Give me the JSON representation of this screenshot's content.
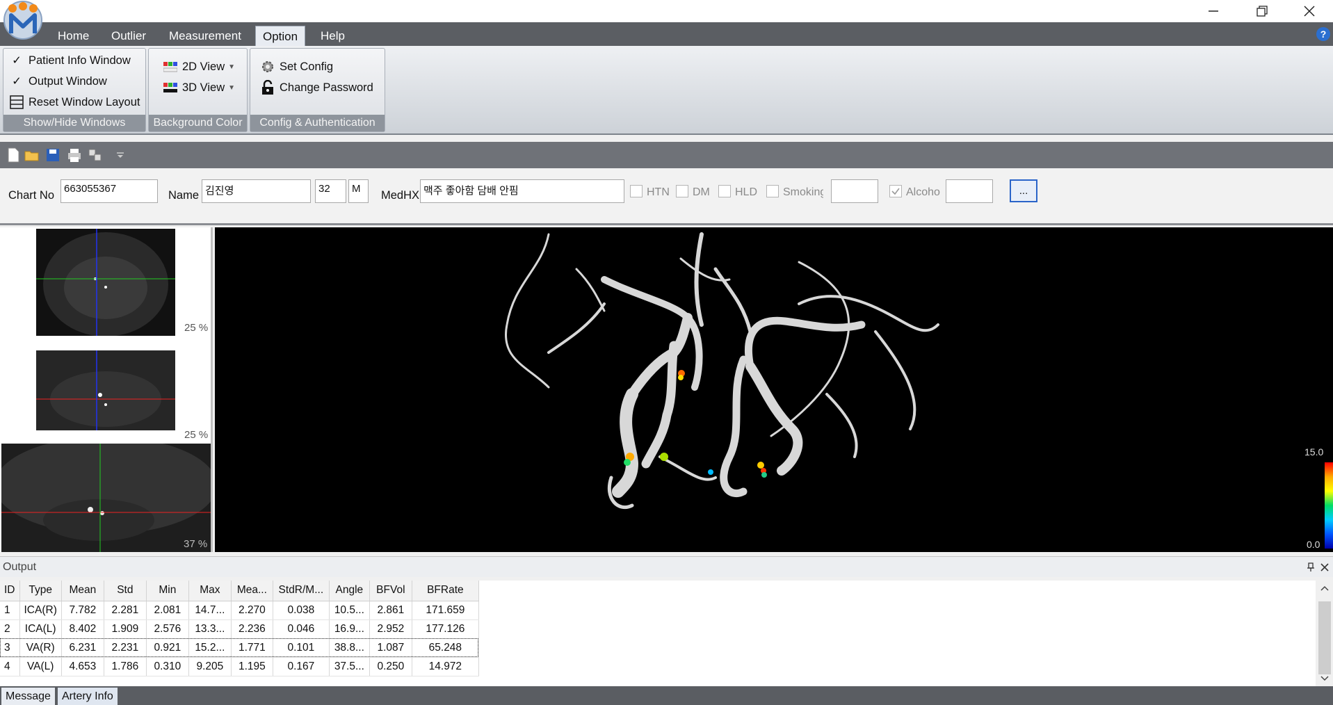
{
  "window": {
    "minimize_icon": "minimize-icon",
    "restore_icon": "restore-icon",
    "close_icon": "close-icon"
  },
  "menu": {
    "items": [
      "Home",
      "Outlier",
      "Measurement",
      "Option",
      "Help"
    ],
    "active": "Option",
    "help_icon": "?"
  },
  "ribbon": {
    "show_hide": {
      "label": "Show/Hide Windows",
      "patient_info": "Patient Info Window",
      "output": "Output Window",
      "reset": "Reset Window Layout",
      "check_mark": "✓"
    },
    "background": {
      "label": "Background Color",
      "view2d": "2D View",
      "view3d": "3D View"
    },
    "config": {
      "label": "Config & Authentication",
      "set_config": "Set Config",
      "change_password": "Change Password"
    }
  },
  "patient": {
    "chart_no_label": "Chart No",
    "chart_no": "663055367",
    "name_label": "Name",
    "name": "김진영",
    "age": "32",
    "sex": "M",
    "medhx_label": "MedHX",
    "medhx": "맥주 좋아함 담배 안핌",
    "htn": "HTN",
    "dm": "DM",
    "hld": "HLD",
    "smoking": "Smoking",
    "alcohol": "Alcoho",
    "more": "..."
  },
  "views": {
    "axial_pct": "25 %",
    "coronal_pct": "25 %",
    "sagittal_pct": "37 %",
    "scale_max": "15.0",
    "scale_min": "0.0"
  },
  "output": {
    "title": "Output",
    "columns": [
      "ID",
      "Type",
      "Mean",
      "Std",
      "Min",
      "Max",
      "Mea...",
      "StdR/M...",
      "Angle",
      "BFVol",
      "BFRate"
    ],
    "rows": [
      [
        "1",
        "ICA(R)",
        "7.782",
        "2.281",
        "2.081",
        "14.7...",
        "2.270",
        "0.038",
        "10.5...",
        "2.861",
        "171.659"
      ],
      [
        "2",
        "ICA(L)",
        "8.402",
        "1.909",
        "2.576",
        "13.3...",
        "2.236",
        "0.046",
        "16.9...",
        "2.952",
        "177.126"
      ],
      [
        "3",
        "VA(R)",
        "6.231",
        "2.231",
        "0.921",
        "15.2...",
        "1.771",
        "0.101",
        "38.8...",
        "1.087",
        "65.248"
      ],
      [
        "4",
        "VA(L)",
        "4.653",
        "1.786",
        "0.310",
        "9.205",
        "1.195",
        "0.167",
        "37.5...",
        "0.250",
        "14.972"
      ]
    ]
  },
  "tabs": {
    "message": "Message",
    "artery_info": "Artery Info"
  }
}
